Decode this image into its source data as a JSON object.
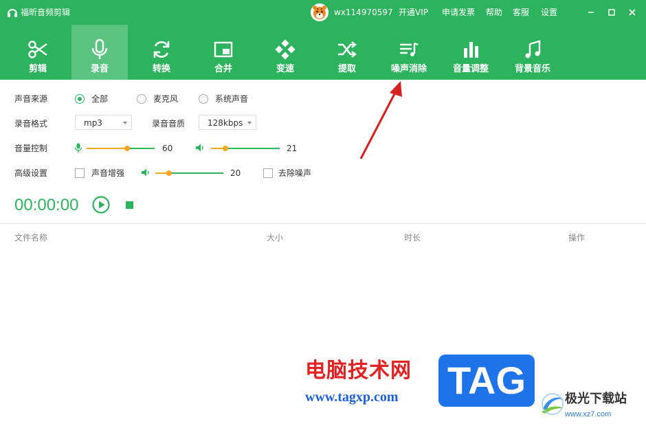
{
  "app": {
    "title": "福昕音频剪辑"
  },
  "user": {
    "name": "wx114970597"
  },
  "top_links": [
    "开通VIP",
    "申请发票",
    "帮助",
    "客服",
    "设置"
  ],
  "toolbar": {
    "items": [
      {
        "label": "剪辑",
        "icon": "scissors-icon"
      },
      {
        "label": "录音",
        "icon": "microphone-icon",
        "active": true
      },
      {
        "label": "转换",
        "icon": "refresh-icon"
      },
      {
        "label": "合并",
        "icon": "picture-in-picture-icon"
      },
      {
        "label": "变速",
        "icon": "diamond-dots-icon"
      },
      {
        "label": "提取",
        "icon": "shuffle-icon"
      },
      {
        "label": "噪声消除",
        "icon": "music-list-icon"
      },
      {
        "label": "音量调整",
        "icon": "bar-chart-icon"
      },
      {
        "label": "背景音乐",
        "icon": "music-note-icon"
      }
    ]
  },
  "settings": {
    "source": {
      "label": "声音来源",
      "options": [
        "全部",
        "麦克风",
        "系统声音"
      ],
      "selected": "全部"
    },
    "format": {
      "label": "录音格式",
      "value": "mp3",
      "quality_label": "录音音质",
      "quality_value": "128kbps"
    },
    "volume": {
      "label": "音量控制",
      "mic_value": "60",
      "speaker_value": "21"
    },
    "advanced": {
      "label": "高级设置",
      "enhance_label": "声音增强",
      "enhance_value": "20",
      "denoise_label": "去除噪声"
    }
  },
  "recorder": {
    "time": "00:00:00"
  },
  "file_table": {
    "columns": [
      "文件名称",
      "大小",
      "时长",
      "操作"
    ]
  },
  "watermark": {
    "cn_text": "电脑技术网",
    "url": "www.tagxp.com",
    "tag": "TAG",
    "site_name": "极光下载站",
    "site_url": "www.xz7.com"
  },
  "colors": {
    "brand_green": "#2db35d",
    "knob_orange": "#f5a623",
    "arrow_red": "#d42020"
  }
}
